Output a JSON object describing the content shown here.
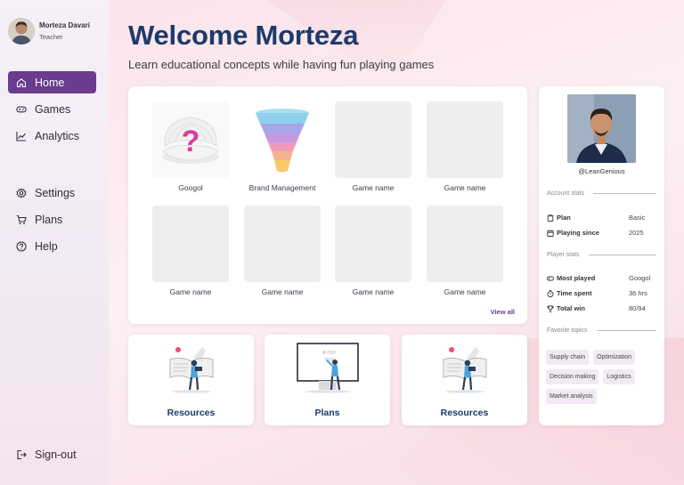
{
  "user": {
    "name": "Morteza Davari",
    "role": "Teacher"
  },
  "nav": {
    "top": [
      {
        "label": "Home",
        "icon": "home-icon",
        "active": true
      },
      {
        "label": "Games",
        "icon": "gamepad-icon",
        "active": false
      },
      {
        "label": "Analytics",
        "icon": "analytics-icon",
        "active": false
      }
    ],
    "bottom": [
      {
        "label": "Settings",
        "icon": "gear-icon"
      },
      {
        "label": "Plans",
        "icon": "cart-icon"
      },
      {
        "label": "Help",
        "icon": "help-icon"
      }
    ],
    "signout": "Sign-out"
  },
  "header": {
    "title": "Welcome Morteza",
    "subtitle": "Learn educational concepts while having fun playing games"
  },
  "games": [
    {
      "name": "Googol",
      "art": "shell-question-icon"
    },
    {
      "name": "Brand Management",
      "art": "funnel-icon"
    },
    {
      "name": "Game name"
    },
    {
      "name": "Game name"
    },
    {
      "name": "Game name"
    },
    {
      "name": "Game name"
    },
    {
      "name": "Game name"
    },
    {
      "name": "Game name"
    }
  ],
  "view_all": "View all",
  "cards": [
    {
      "label": "Resources",
      "art": "reading-person-illustration"
    },
    {
      "label": "Plans",
      "art": "presentation-person-illustration"
    },
    {
      "label": "Resources",
      "art": "reading-person-illustration"
    }
  ],
  "profile_panel": {
    "handle": "@LeanGenious",
    "account_stats_title": "Account stats",
    "account_stats": [
      {
        "label": "Plan",
        "value": "Basic",
        "icon": "clipboard-icon"
      },
      {
        "label": "Playing since",
        "value": "2025",
        "icon": "calendar-icon"
      }
    ],
    "player_stats_title": "Player stats",
    "player_stats": [
      {
        "label": "Most played",
        "value": "Googol",
        "icon": "gamepad-icon"
      },
      {
        "label": "Time spent",
        "value": "36 hrs",
        "icon": "stopwatch-icon"
      },
      {
        "label": "Total win",
        "value": "80/94",
        "icon": "trophy-icon"
      }
    ],
    "topics_title": "Favorite topics",
    "topics": [
      "Supply chain",
      "Optimization",
      "Decision making",
      "Logistics",
      "Market analysis"
    ]
  },
  "colors": {
    "accent": "#6a3b8f",
    "title": "#1d3a6b",
    "placeholder": "#eeeeee"
  }
}
